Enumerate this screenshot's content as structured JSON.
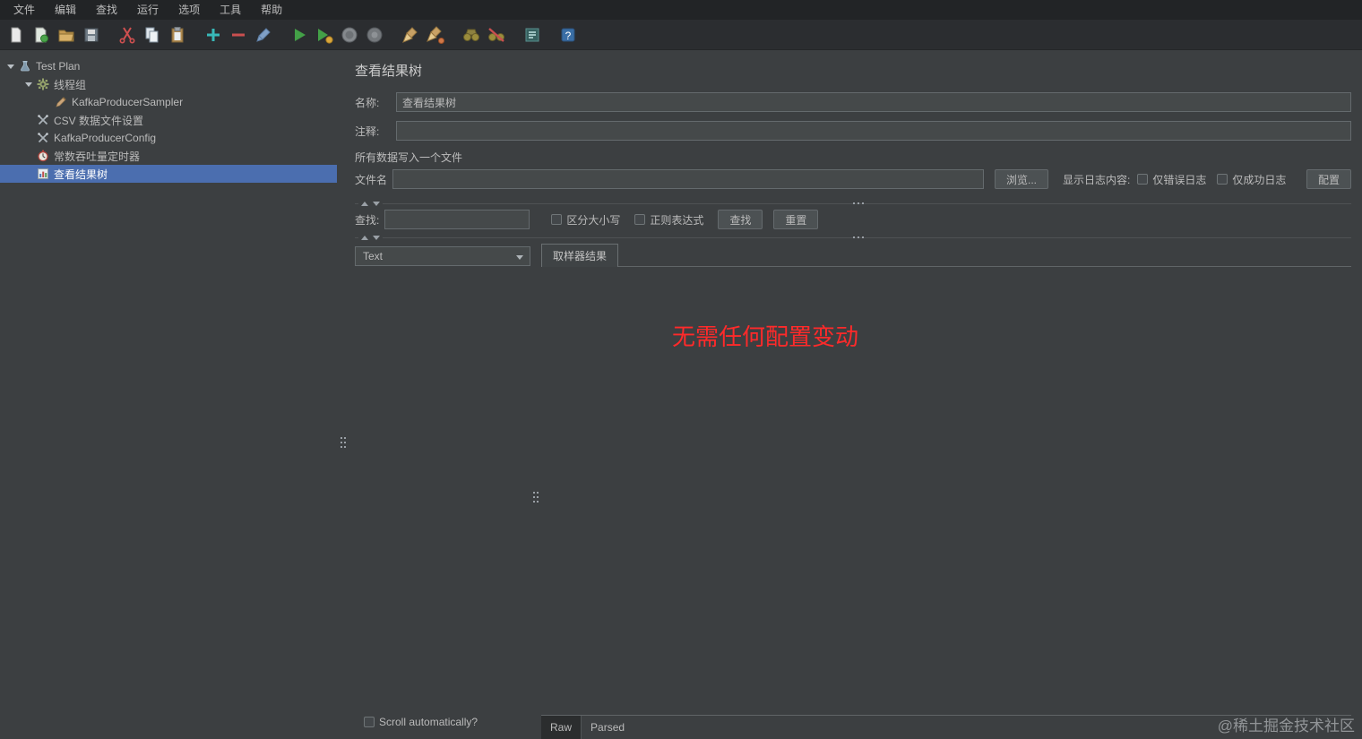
{
  "menu": {
    "items": [
      "文件",
      "编辑",
      "查找",
      "运行",
      "选项",
      "工具",
      "帮助"
    ]
  },
  "toolbar": {
    "icons": [
      "new-file",
      "new-from-template",
      "open-file",
      "save",
      "cut",
      "copy",
      "paste",
      "add-element",
      "remove-element",
      "toggle-element",
      "start",
      "start-no-timers",
      "stop",
      "shutdown",
      "clear",
      "clear-all",
      "search",
      "search-reset",
      "function-helper",
      "help"
    ]
  },
  "tree": {
    "items": [
      {
        "label": "Test Plan",
        "level": 0,
        "icon": "test-plan",
        "expanded": true,
        "selected": false
      },
      {
        "label": "线程组",
        "level": 1,
        "icon": "thread-group",
        "expanded": true,
        "selected": false
      },
      {
        "label": "KafkaProducerSampler",
        "level": 2,
        "icon": "sampler",
        "selected": false
      },
      {
        "label": "CSV 数据文件设置",
        "level": 1,
        "icon": "config-element",
        "selected": false
      },
      {
        "label": "KafkaProducerConfig",
        "level": 1,
        "icon": "config-element",
        "selected": false
      },
      {
        "label": "常数吞吐量定时器",
        "level": 1,
        "icon": "timer",
        "selected": false
      },
      {
        "label": "查看结果树",
        "level": 1,
        "icon": "results-tree",
        "selected": true
      }
    ]
  },
  "panel": {
    "title": "查看结果树",
    "name_label": "名称:",
    "name_value": "查看结果树",
    "comment_label": "注释:",
    "comment_value": "",
    "write_section_label": "所有数据写入一个文件",
    "filename_label": "文件名",
    "filename_value": "",
    "browse_button": "浏览...",
    "display_log_label": "显示日志内容:",
    "errors_only_label": "仅错误日志",
    "success_only_label": "仅成功日志",
    "config_button": "配置",
    "search_label": "查找:",
    "search_value": "",
    "case_sensitive_label": "区分大小写",
    "regex_label": "正则表达式",
    "find_button": "查找",
    "reset_button": "重置",
    "renderer_value": "Text",
    "sampler_result_tab": "取样器结果",
    "message": "无需任何配置变动",
    "scroll_label": "Scroll automatically?",
    "raw_tab": "Raw",
    "parsed_tab": "Parsed"
  },
  "watermark": "@稀土掘金技术社区",
  "colors": {
    "selection_blue": "#4b6eaf",
    "message_red": "#ff2a2a",
    "panel_bg": "#3c3f41",
    "topbar_bg": "#222426"
  }
}
